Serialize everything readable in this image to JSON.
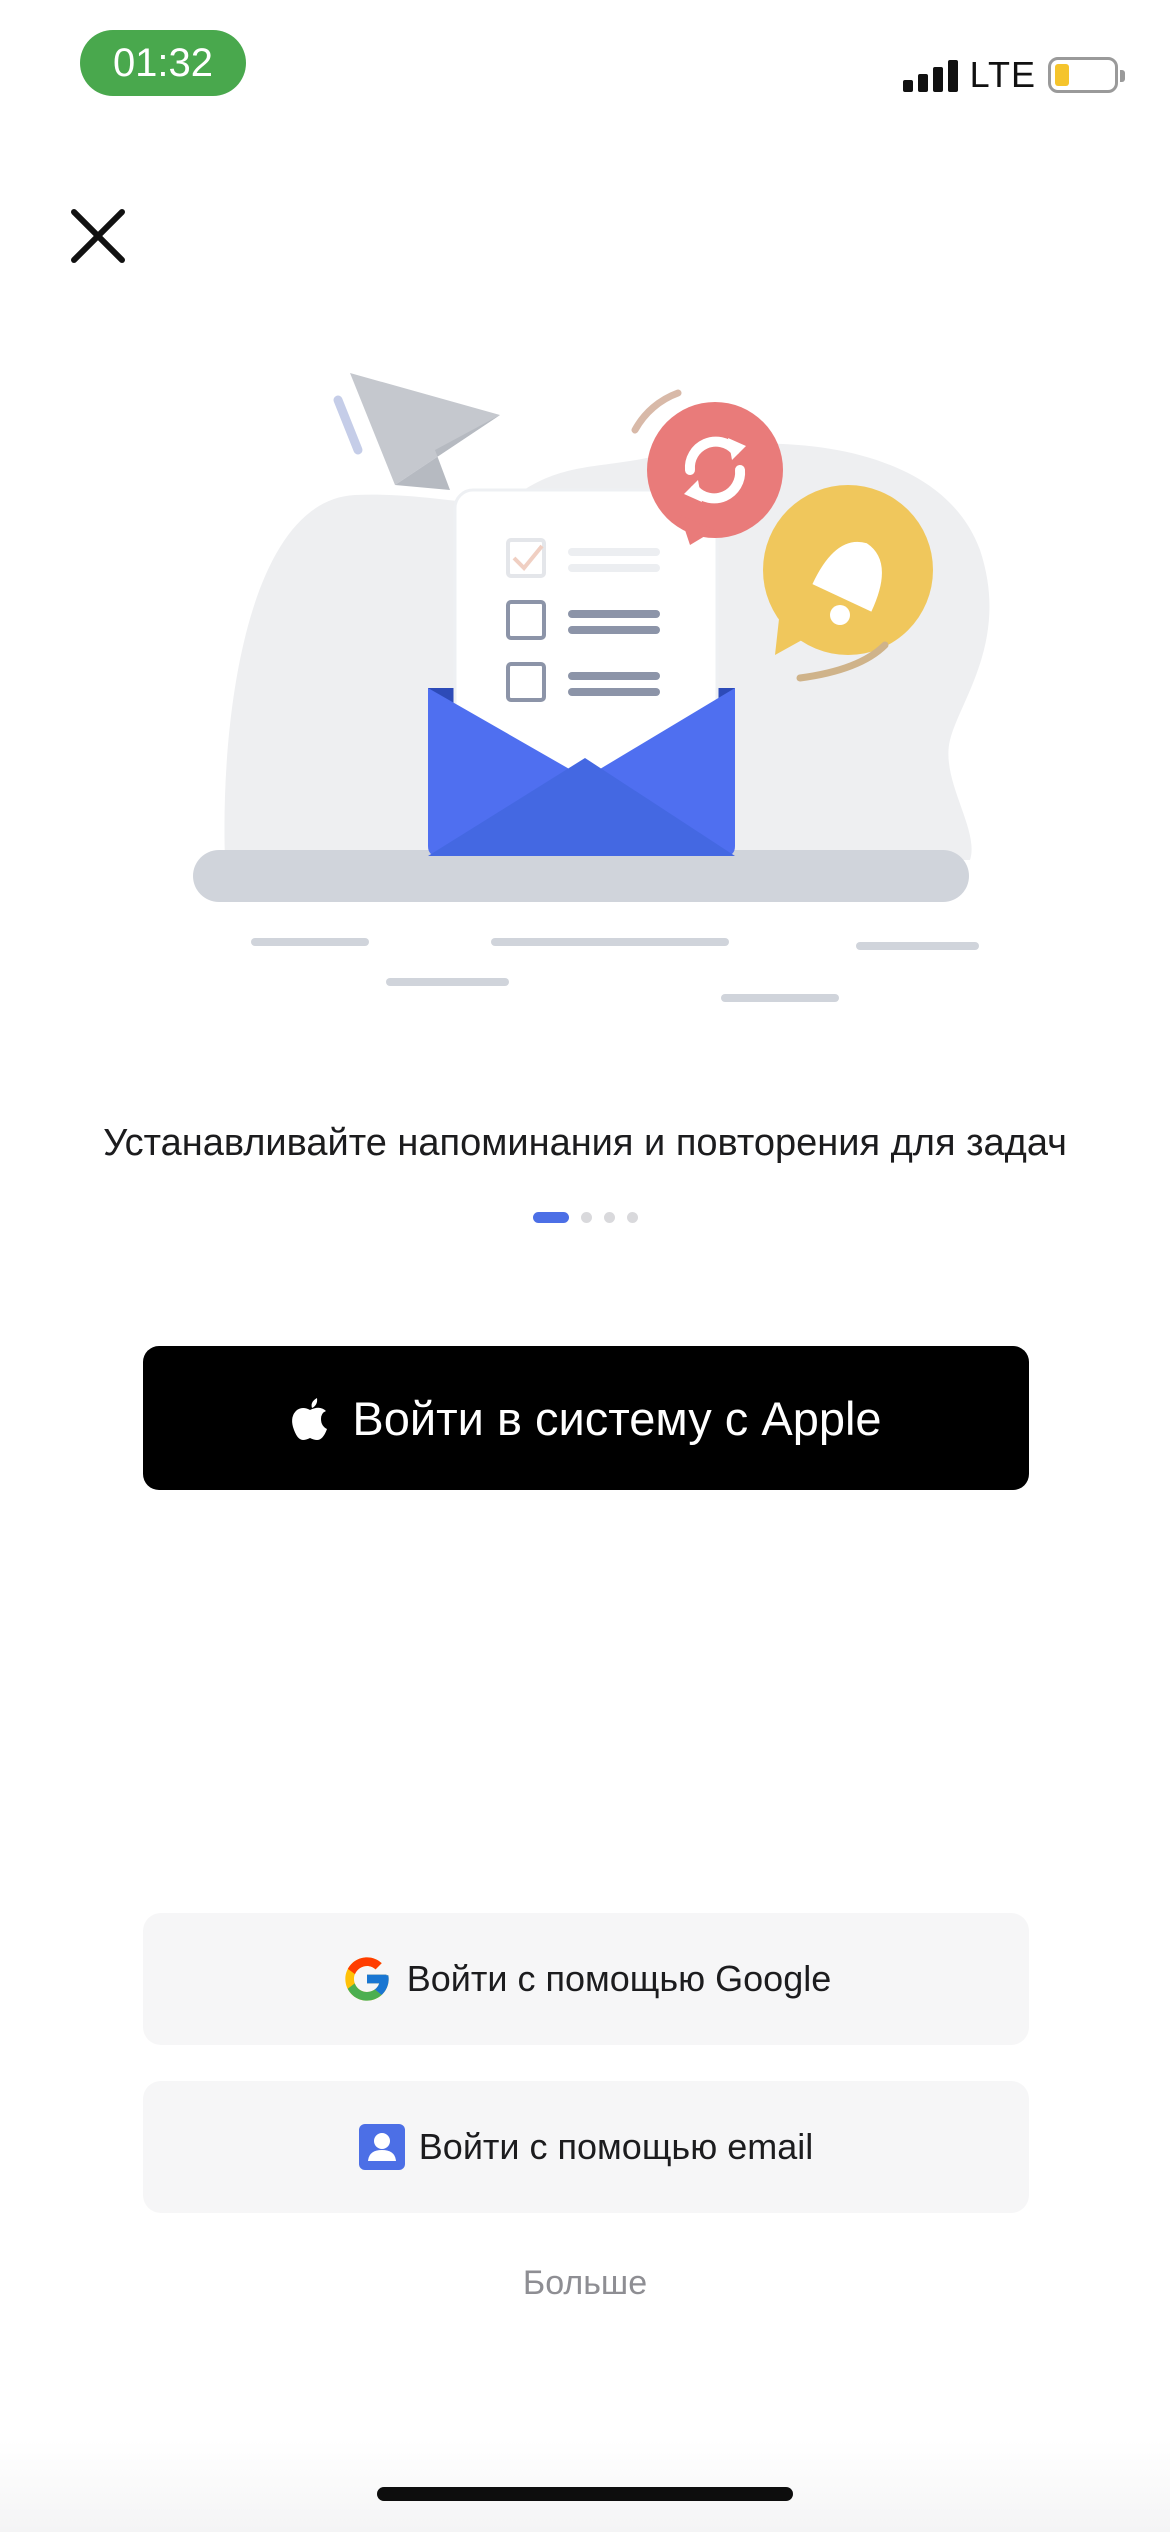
{
  "status_bar": {
    "time": "01:32",
    "network": "LTE",
    "battery_color": "#f5c42c",
    "time_pill_color": "#49a84d"
  },
  "header": {
    "close_icon": "close-icon"
  },
  "illustration": {
    "icons": [
      "paper-plane-icon",
      "envelope-icon",
      "checklist-icon",
      "repeat-icon",
      "bell-icon"
    ]
  },
  "onboarding": {
    "headline": "Устанавливайте напоминания и повторения для задач",
    "pager": {
      "current_page": 1,
      "total_pages": 4
    }
  },
  "auth": {
    "apple_label": "Войти в систему с Apple",
    "google_label": "Войти с помощью Google",
    "email_label": "Войти с помощью email",
    "more_label": "Больше"
  },
  "colors": {
    "accent": "#4c6fe6",
    "apple_button_bg": "#000000",
    "secondary_button_bg": "#f6f6f7",
    "more_text": "#8e8e93"
  }
}
